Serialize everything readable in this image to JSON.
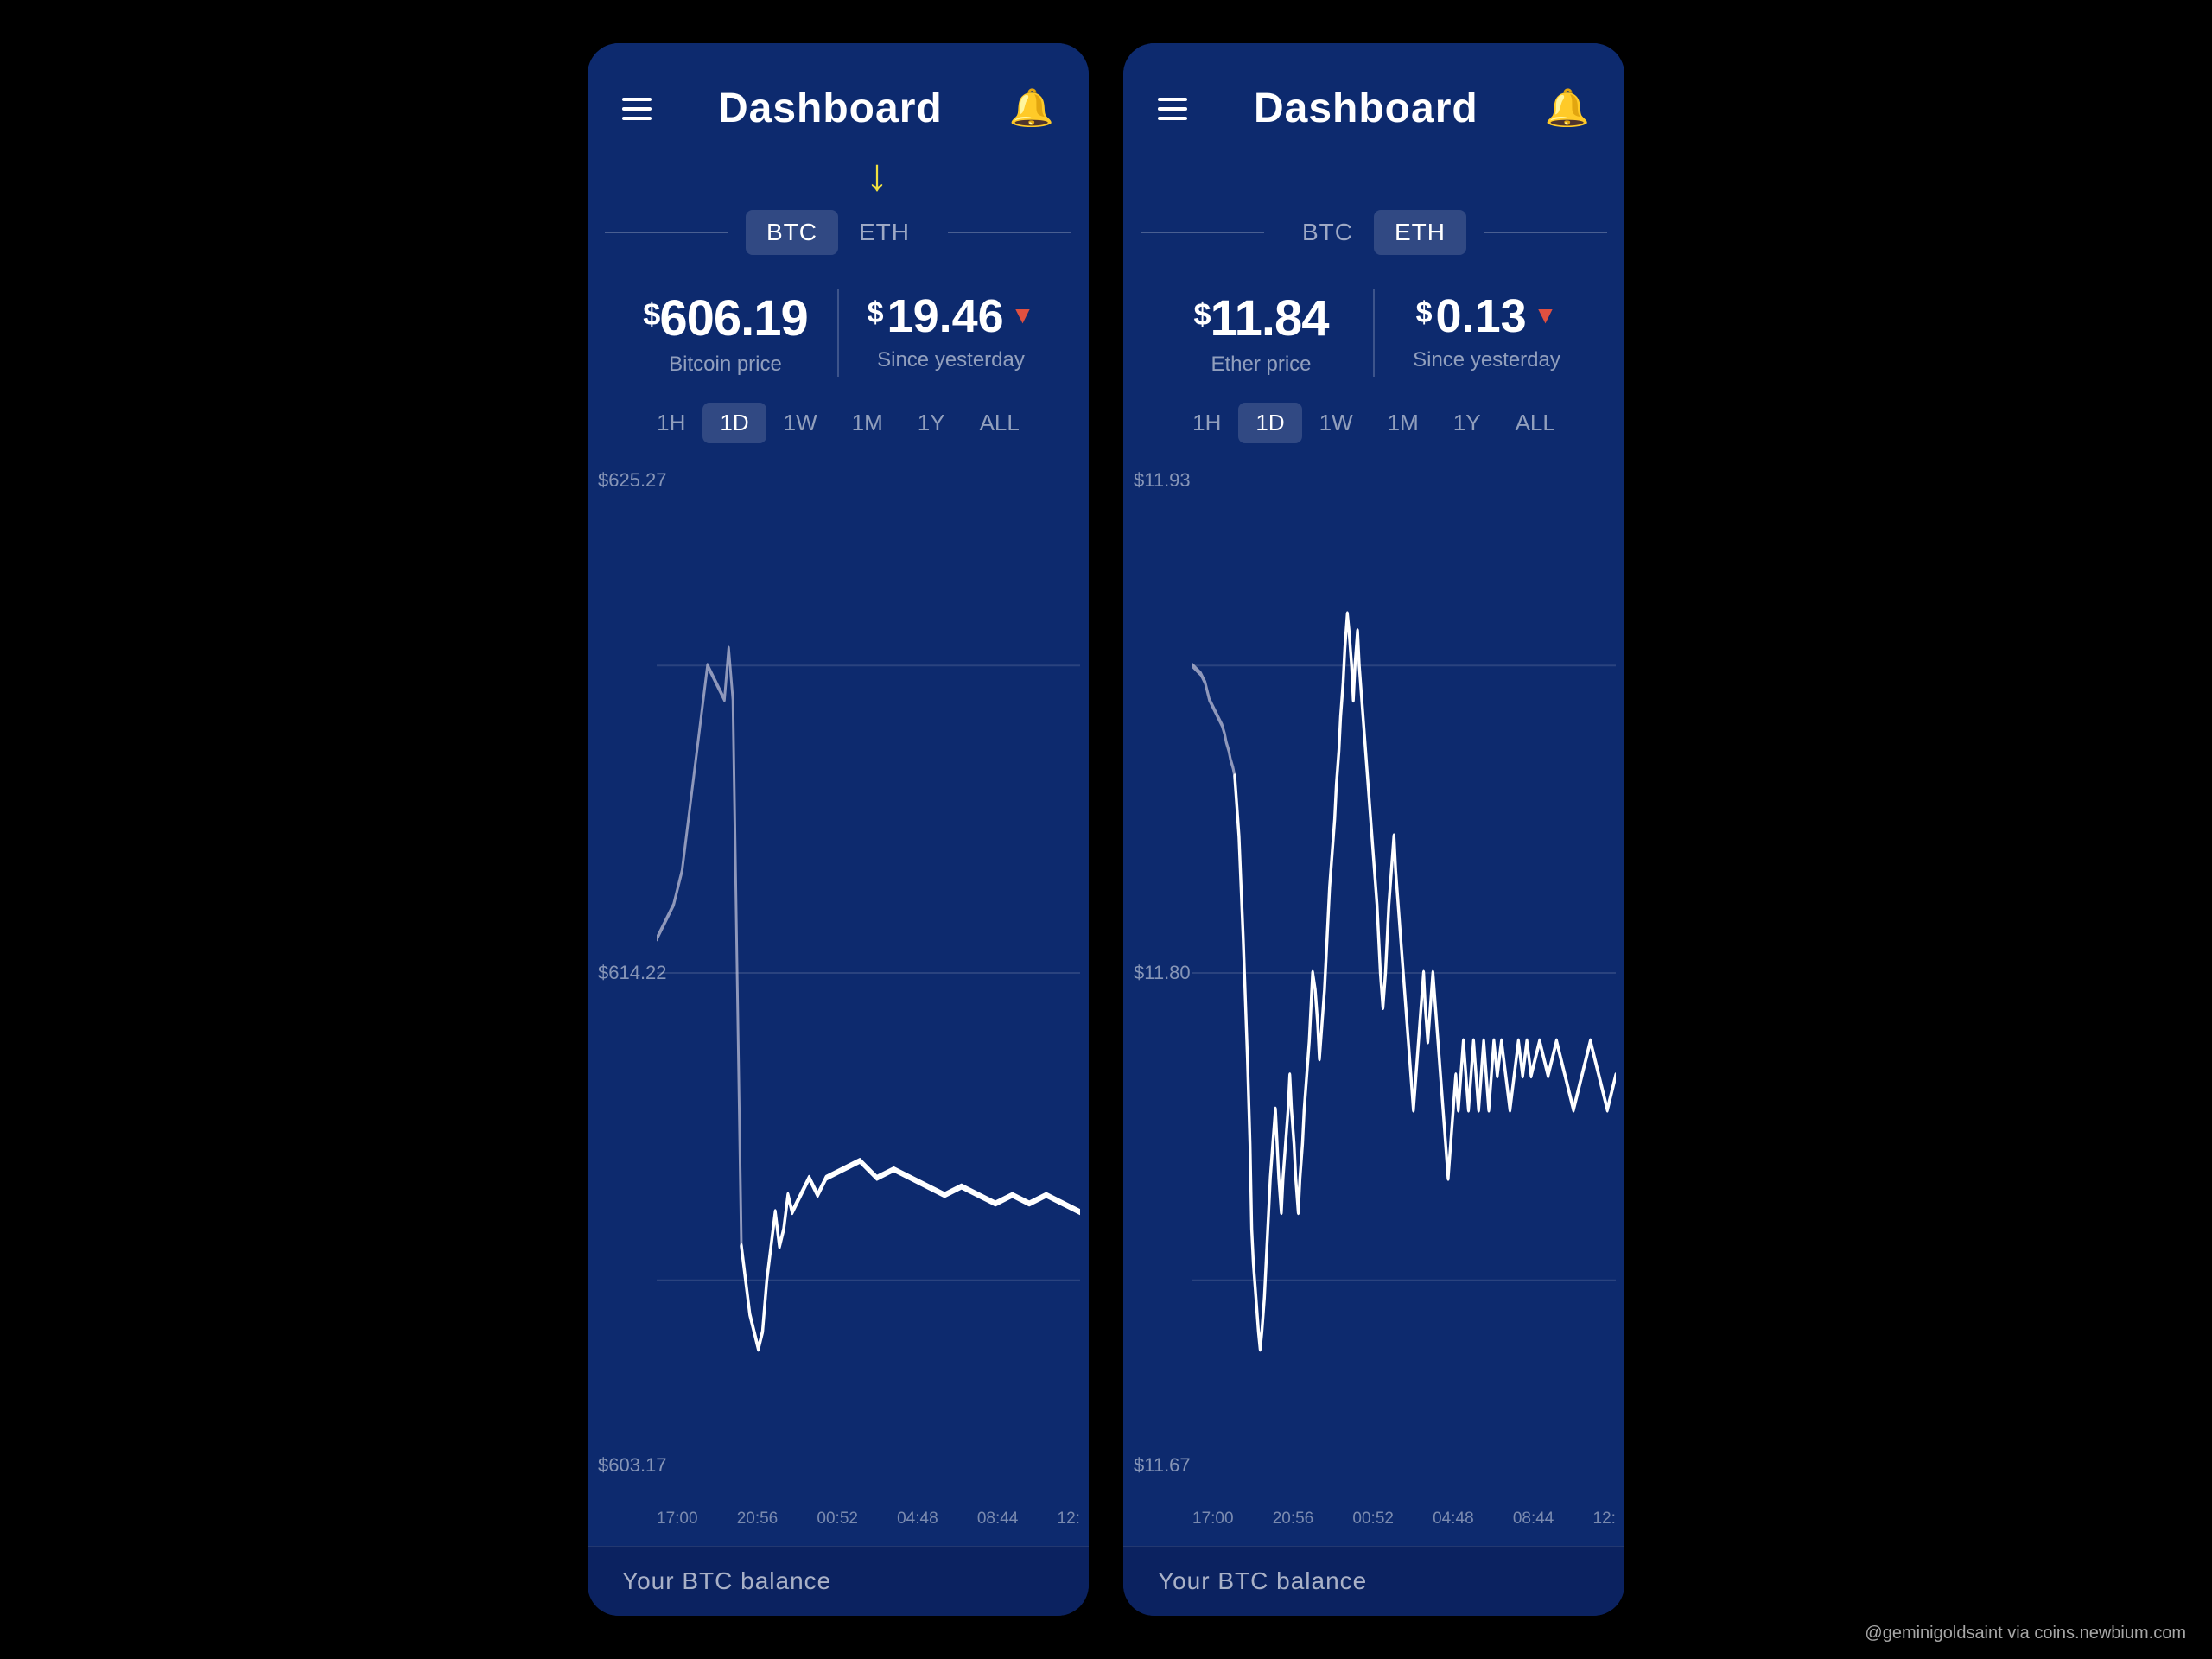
{
  "left_panel": {
    "title": "Dashboard",
    "tabs": [
      "BTC",
      "ETH"
    ],
    "active_tab": "BTC",
    "arrow_visible": true,
    "price": {
      "main": "606.19",
      "main_label": "Bitcoin price",
      "change": "19.46",
      "change_label": "Since yesterday",
      "change_direction": "down"
    },
    "timeframes": [
      "1H",
      "1D",
      "1W",
      "1M",
      "1Y",
      "ALL"
    ],
    "active_timeframe": "1D",
    "chart": {
      "y_labels": [
        "$625.27",
        "$614.22",
        "$603.17"
      ],
      "x_labels": [
        "17:00",
        "20:56",
        "00:52",
        "04:48",
        "08:44",
        "12:"
      ]
    },
    "balance_label": "Your BTC balance"
  },
  "right_panel": {
    "title": "Dashboard",
    "tabs": [
      "BTC",
      "ETH"
    ],
    "active_tab": "ETH",
    "arrow_visible": false,
    "price": {
      "main": "11.84",
      "main_label": "Ether price",
      "change": "0.13",
      "change_label": "Since yesterday",
      "change_direction": "down"
    },
    "timeframes": [
      "1H",
      "1D",
      "1W",
      "1M",
      "1Y",
      "ALL"
    ],
    "active_timeframe": "1D",
    "chart": {
      "y_labels": [
        "$11.93",
        "$11.80",
        "$11.67"
      ],
      "x_labels": [
        "17:00",
        "20:56",
        "00:52",
        "04:48",
        "08:44",
        "12:"
      ]
    },
    "balance_label": "Your BTC balance"
  },
  "watermark": "@geminigoldsaint via coins.newbium.com",
  "colors": {
    "bg": "#0d2a6e",
    "card_dark": "#0b2260",
    "accent_yellow": "#f0e040",
    "accent_red": "#e05040"
  }
}
